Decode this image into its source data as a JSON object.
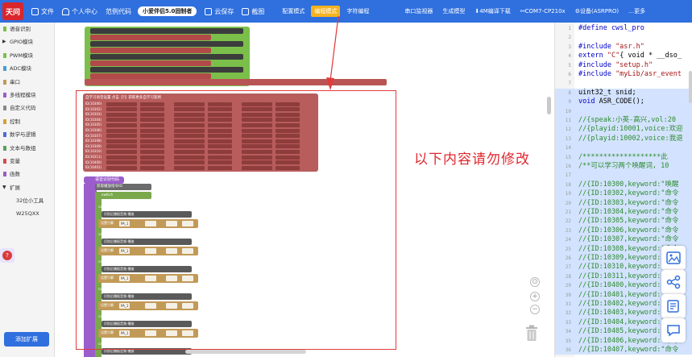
{
  "colors": {
    "topbar": "#2f6fde",
    "accent_mode": "#f5b321",
    "annotation_red": "#e23b3b",
    "block_green": "#7bbf4a",
    "block_red": "#b85c5c",
    "block_purple": "#9b5ccc",
    "block_gold": "#c29a57"
  },
  "toolbar": {
    "logo": "天问",
    "file": "文件",
    "profile": "个人中心",
    "examples": "范例代码",
    "project_name": "小爱伴侣5.0固制者",
    "cloud_save": "云保存",
    "screenshot": "截图",
    "modes": [
      "配置模式",
      "编程模式",
      "字符编程"
    ],
    "serial_monitor": "串口监视器",
    "generate_model": "生成模型",
    "download": "4M编译下载",
    "port": "COM7-CP210x",
    "device": "设备(ASRPRO)",
    "more": "更多"
  },
  "sidebar": {
    "categories": [
      {
        "label": "语音识别",
        "color": "#7bbf4a"
      },
      {
        "label": "GPIO模块",
        "color": "#333333",
        "expand": "▶"
      },
      {
        "label": "PWM模块",
        "color": "#7bbf4a"
      },
      {
        "label": "ADC模块",
        "color": "#4a9bd8"
      },
      {
        "label": "串口",
        "color": "#c29a57"
      },
      {
        "label": "多线程模块",
        "color": "#9b5ccc"
      },
      {
        "label": "自定义代码",
        "color": "#888888"
      },
      {
        "label": "控制",
        "color": "#d8a030"
      },
      {
        "label": "数学与逻辑",
        "color": "#4a6bd8"
      },
      {
        "label": "文本与数组",
        "color": "#5aa05a"
      },
      {
        "label": "变量",
        "color": "#d84a4a"
      },
      {
        "label": "函数",
        "color": "#9b5ccc"
      },
      {
        "label": "扩展",
        "color": "#333333",
        "expand": "▼"
      }
    ],
    "sub_items": [
      "32位小工具",
      "W25QXX"
    ],
    "add_extension": "添加扩展"
  },
  "workspace": {
    "annotation_note": "以下内容请勿修改",
    "keyword_header": "自学习语音设置 点击【?】获取更多自学习案例",
    "keyword_ids": [
      "ID(10300)",
      "ID(10302)",
      "ID(10303)",
      "ID(10304)",
      "ID(10305)",
      "ID(10306)",
      "ID(10307)",
      "ID(10308)",
      "ID(10309)",
      "ID(10310)",
      "ID(10311)",
      "ID(10400)",
      "ID(10401)"
    ],
    "asr_hat": "语音识别代码",
    "asr_call": "获取播放指令ID",
    "switch_label": "switch",
    "case_label": "case",
    "say_text": "识别后播报音频-播放",
    "pin_action": "设置引脚",
    "pin_value": "PA_1"
  },
  "code": {
    "lines": [
      {
        "n": "1",
        "segments": [
          {
            "t": "#define cwsl_pro",
            "c": "kw"
          }
        ]
      },
      {
        "n": "2",
        "segments": []
      },
      {
        "n": "3",
        "segments": [
          {
            "t": "#include ",
            "c": "kw"
          },
          {
            "t": "\"asr.h\"",
            "c": "st"
          }
        ]
      },
      {
        "n": "4",
        "segments": [
          {
            "t": "extern ",
            "c": "kw"
          },
          {
            "t": "\"C\"",
            "c": "st"
          },
          {
            "t": "{ void * __dso_",
            "c": ""
          }
        ]
      },
      {
        "n": "5",
        "segments": [
          {
            "t": "#include ",
            "c": "kw"
          },
          {
            "t": "\"setup.h\"",
            "c": "st"
          }
        ]
      },
      {
        "n": "6",
        "segments": [
          {
            "t": "#include ",
            "c": "kw"
          },
          {
            "t": "\"myLib/asr_event",
            "c": "st"
          }
        ]
      },
      {
        "n": "7",
        "segments": []
      },
      {
        "n": "8",
        "segments": [
          {
            "t": "uint32_t snid;",
            "c": ""
          }
        ]
      },
      {
        "n": "9",
        "segments": [
          {
            "t": "void ",
            "c": "kw"
          },
          {
            "t": "ASR_CODE();",
            "c": ""
          }
        ]
      },
      {
        "n": "10",
        "segments": []
      },
      {
        "n": "11",
        "segments": [
          {
            "t": "//{speak:小英-高兴,vol:20",
            "c": "cm"
          }
        ]
      },
      {
        "n": "12",
        "segments": [
          {
            "t": "//{playid:10001,voice:欢迎",
            "c": "cm"
          }
        ]
      },
      {
        "n": "13",
        "segments": [
          {
            "t": "//{playid:10002,voice:我退",
            "c": "cm"
          }
        ]
      },
      {
        "n": "14",
        "segments": []
      },
      {
        "n": "15",
        "segments": [
          {
            "t": "/*******************此",
            "c": "cm"
          }
        ]
      },
      {
        "n": "16",
        "segments": [
          {
            "t": "/**可以学习两个唤醒词, 10",
            "c": "cm"
          }
        ]
      },
      {
        "n": "17",
        "segments": []
      },
      {
        "n": "18",
        "segments": [
          {
            "t": "//{ID:10300,keyword:\"唤醒",
            "c": "cm"
          }
        ]
      },
      {
        "n": "19",
        "segments": [
          {
            "t": "//{ID:10302,keyword:\"命令",
            "c": "cm"
          }
        ]
      },
      {
        "n": "20",
        "segments": [
          {
            "t": "//{ID:10303,keyword:\"命令",
            "c": "cm"
          }
        ]
      },
      {
        "n": "21",
        "segments": [
          {
            "t": "//{ID:10304,keyword:\"命令",
            "c": "cm"
          }
        ]
      },
      {
        "n": "22",
        "segments": [
          {
            "t": "//{ID:10305,keyword:\"命令",
            "c": "cm"
          }
        ]
      },
      {
        "n": "23",
        "segments": [
          {
            "t": "//{ID:10306,keyword:\"命令",
            "c": "cm"
          }
        ]
      },
      {
        "n": "24",
        "segments": [
          {
            "t": "//{ID:10307,keyword:\"命令",
            "c": "cm"
          }
        ]
      },
      {
        "n": "25",
        "segments": [
          {
            "t": "//{ID:10308,keyword:\"命令",
            "c": "cm"
          }
        ]
      },
      {
        "n": "26",
        "segments": [
          {
            "t": "//{ID:10309,keyword:\"命令",
            "c": "cm"
          }
        ]
      },
      {
        "n": "27",
        "segments": [
          {
            "t": "//{ID:10310,keyword:\"命令",
            "c": "cm"
          }
        ]
      },
      {
        "n": "28",
        "segments": [
          {
            "t": "//{ID:10311,keyword:\"命令",
            "c": "cm"
          }
        ]
      },
      {
        "n": "29",
        "segments": [
          {
            "t": "//{ID:10400,keyword:\"命令",
            "c": "cm"
          }
        ]
      },
      {
        "n": "30",
        "segments": [
          {
            "t": "//{ID:10401,keyword:\"命令",
            "c": "cm"
          }
        ]
      },
      {
        "n": "31",
        "segments": [
          {
            "t": "//{ID:10402,keyword:\"命令",
            "c": "cm"
          }
        ]
      },
      {
        "n": "32",
        "segments": [
          {
            "t": "//{ID:10403,keyword:\"命令",
            "c": "cm"
          }
        ]
      },
      {
        "n": "33",
        "segments": [
          {
            "t": "//{ID:10404,keyword:\"命令",
            "c": "cm"
          }
        ]
      },
      {
        "n": "34",
        "segments": [
          {
            "t": "//{ID:10405,keyword:\"命令",
            "c": "cm"
          }
        ]
      },
      {
        "n": "35",
        "segments": [
          {
            "t": "//{ID:10406,keyword:\"命令",
            "c": "cm"
          }
        ]
      },
      {
        "n": "36",
        "segments": [
          {
            "t": "//{ID:10407,keyword:\"命令",
            "c": "cm"
          }
        ]
      }
    ]
  }
}
